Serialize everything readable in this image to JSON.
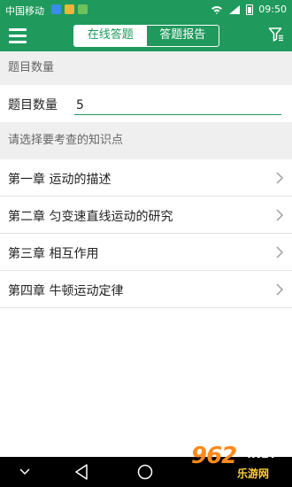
{
  "status_bar": {
    "carrier": "中国移动",
    "battery": "95",
    "time": "09:50",
    "indicator_colors": [
      "#3a8ee6",
      "#e8b83a",
      "#6fc25a"
    ]
  },
  "app_bar": {
    "tabs": [
      {
        "label": "在线答题",
        "active": true
      },
      {
        "label": "答题报告",
        "active": false
      }
    ],
    "icons": [
      "menu-icon",
      "filter-icon"
    ]
  },
  "count_section": {
    "header": "题目数量",
    "label": "题目数量",
    "value": "5"
  },
  "topics_section": {
    "header": "请选择要考查的知识点",
    "items": [
      {
        "label": "第一章 运动的描述"
      },
      {
        "label": "第二章 匀变速直线运动的研究"
      },
      {
        "label": "第三章 相互作用"
      },
      {
        "label": "第四章 牛顿运动定律"
      }
    ]
  },
  "watermark": {
    "number": "962",
    "suffix": ".NET",
    "text": "乐游网"
  },
  "colors": {
    "primary": "#1f9a5c",
    "section_bg": "#efefef"
  }
}
